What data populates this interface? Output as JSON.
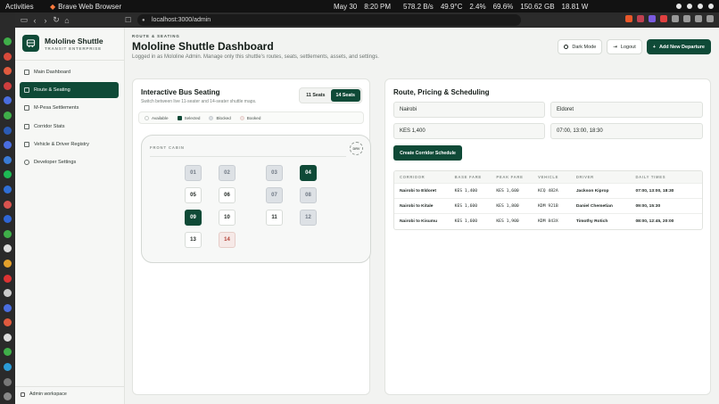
{
  "os": {
    "activities": "Activities",
    "app_name": "Brave Web Browser",
    "date": "May 30",
    "time": "8:20 PM",
    "net_speed": "578.2 B/s",
    "temp": "49.9°C",
    "cpu": "2.4%",
    "mem": "69.6%",
    "disk": "150.62 GB",
    "power": "18.81 W"
  },
  "browser": {
    "url": "localhost:3000/admin"
  },
  "sidebar": {
    "brand_title": "Mololine Shuttle",
    "brand_sub": "TRANSIT ENTERPRISE",
    "items": [
      {
        "label": "Main Dashboard"
      },
      {
        "label": "Route & Seating"
      },
      {
        "label": "M-Pesa Settlements"
      },
      {
        "label": "Corridor Stats"
      },
      {
        "label": "Vehicle & Driver Registry"
      },
      {
        "label": "Developer Settings"
      }
    ],
    "footer": "Admin workspace"
  },
  "header": {
    "breadcrumb": "ROUTE & SEATING",
    "title": "Mololine Shuttle Dashboard",
    "subtitle": "Logged in as Mololine Admin. Manage only this shuttle's routes, seats, settlements, assets, and settings.",
    "dark_mode": "Dark Mode",
    "logout": "Logout",
    "add_departure": "Add New Departure"
  },
  "seating": {
    "title": "Interactive Bus Seating",
    "subtitle": "Switch between live 11-seater and 14-seater shuttle maps.",
    "toggle_11": "11 Seats",
    "toggle_14": "14 Seats",
    "legend": {
      "available": "Available",
      "selected": "Selected",
      "blocked": "Blocked",
      "booked": "Booked"
    },
    "front_cabin": "FRONT CABIN",
    "driver": "DRV",
    "seats": [
      {
        "label": "01",
        "state": "blocked"
      },
      {
        "label": "02",
        "state": "blocked"
      },
      {
        "label": "03",
        "state": "blocked"
      },
      {
        "label": "04",
        "state": "selected"
      },
      {
        "label": "05",
        "state": "available"
      },
      {
        "label": "06",
        "state": "available"
      },
      {
        "label": "07",
        "state": "blocked"
      },
      {
        "label": "08",
        "state": "blocked"
      },
      {
        "label": "09",
        "state": "selected"
      },
      {
        "label": "10",
        "state": "available"
      },
      {
        "label": "11",
        "state": "available"
      },
      {
        "label": "12",
        "state": "blocked"
      },
      {
        "label": "13",
        "state": "available"
      },
      {
        "label": "14",
        "state": "booked"
      }
    ]
  },
  "routing": {
    "title": "Route, Pricing & Scheduling",
    "origin": "Nairobi",
    "destination": "Eldoret",
    "fare": "KES 1,400",
    "times": "07:00, 13:00, 18:30",
    "create_btn": "Create Corridor Schedule",
    "columns": [
      "CORRIDOR",
      "BASE FARE",
      "PEAK FARE",
      "VEHICLE",
      "DRIVER",
      "DAILY TIMES"
    ],
    "rows": [
      {
        "corridor": "Nairobi to Eldoret",
        "base": "KES 1,400",
        "peak": "KES 1,600",
        "vehicle": "KCQ 482A",
        "driver": "Jackson Kiprop",
        "times": "07:00, 13:00, 18:30"
      },
      {
        "corridor": "Nairobi to Kitale",
        "base": "KES 1,600",
        "peak": "KES 1,800",
        "vehicle": "KDM 921B",
        "driver": "Daniel Chemetian",
        "times": "09:00, 15:30"
      },
      {
        "corridor": "Nairobi to Kisumu",
        "base": "KES 1,600",
        "peak": "KES 1,900",
        "vehicle": "KDM 843X",
        "driver": "Timothy Rotich",
        "times": "08:00, 12:45, 20:00"
      }
    ]
  },
  "colors": {
    "brand": "#0f4a37",
    "booked": "#b34135"
  }
}
